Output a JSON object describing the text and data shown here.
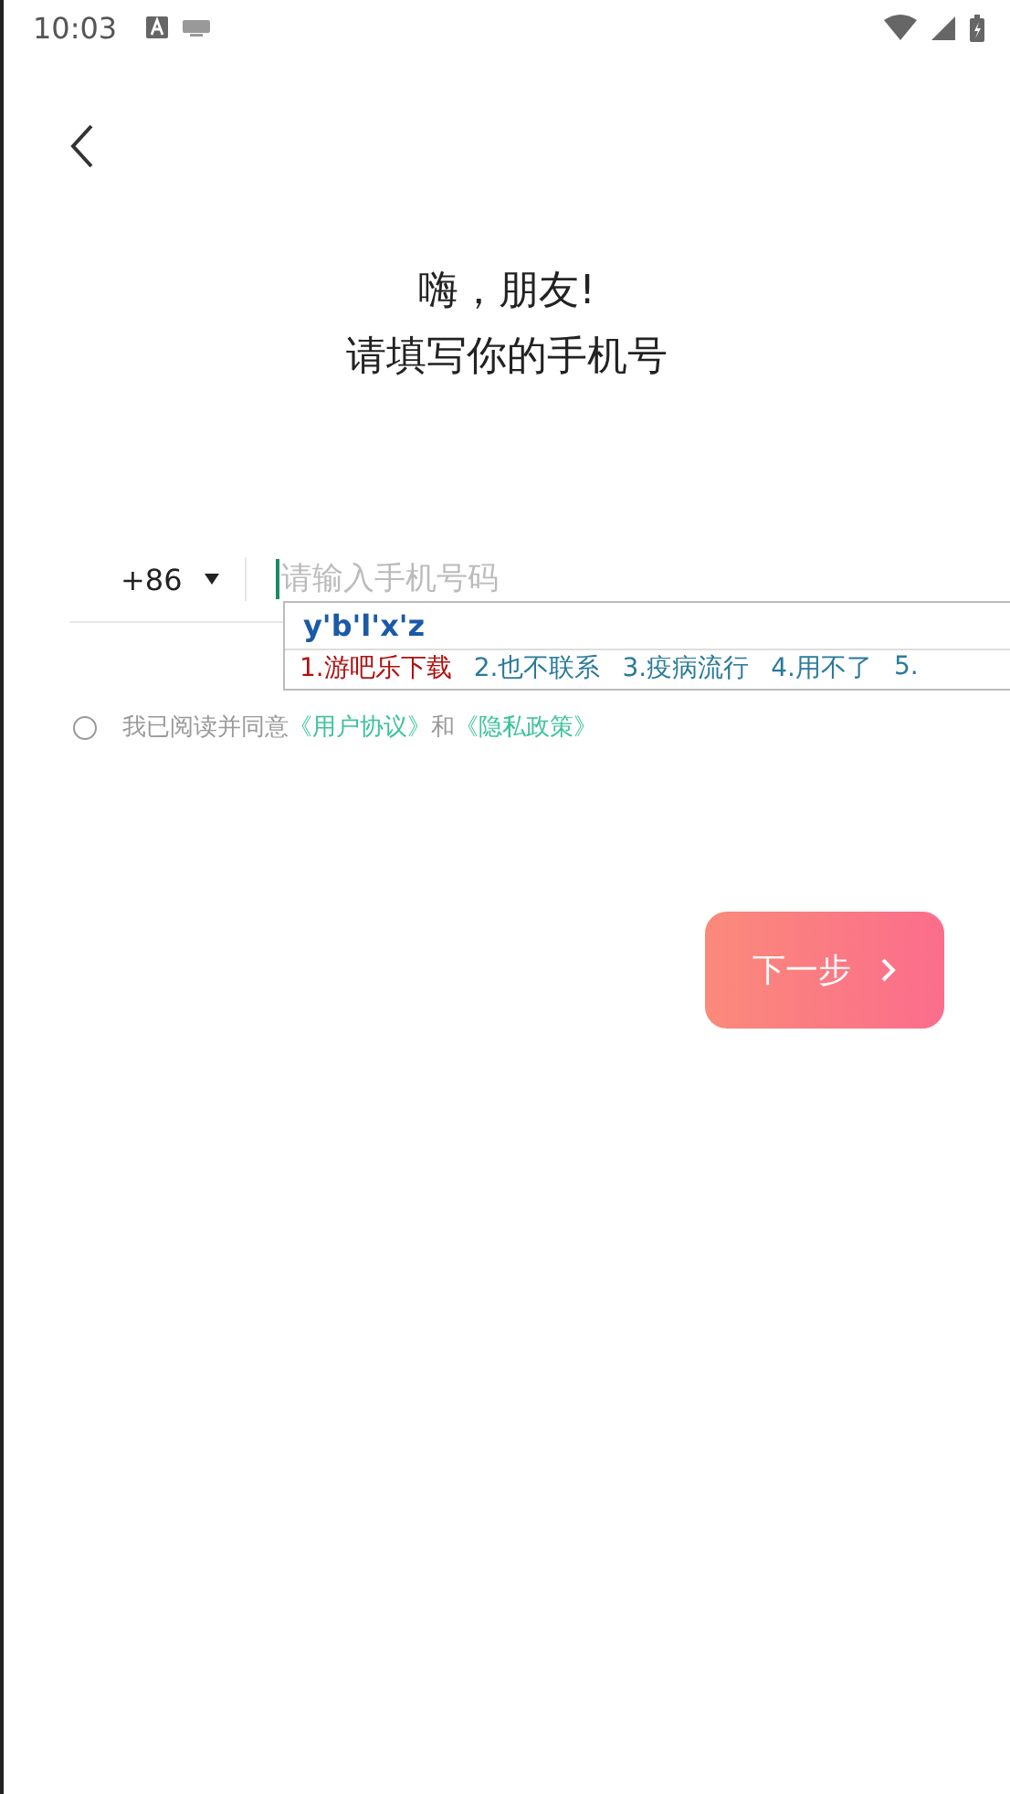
{
  "status_bar": {
    "time": "10:03"
  },
  "greeting": {
    "line_1": "嗨，朋友!",
    "line_2": "请填写你的手机号"
  },
  "phone": {
    "country_code": "+86",
    "placeholder": "请输入手机号码"
  },
  "ime": {
    "composition": "y'b'l'x'z",
    "candidates": [
      {
        "text": "1.游吧乐下载",
        "selected": true
      },
      {
        "text": "2.也不联系",
        "selected": false
      },
      {
        "text": "3.疫病流行",
        "selected": false
      },
      {
        "text": "4.用不了",
        "selected": false
      },
      {
        "text": "5.",
        "selected": false
      }
    ]
  },
  "consent": {
    "checked": false,
    "prefix": "我已阅读并同意",
    "link_1": "《用户协议》",
    "joiner": "和",
    "link_2": "《隐私政策》"
  },
  "next_button": {
    "label": "下一步"
  }
}
